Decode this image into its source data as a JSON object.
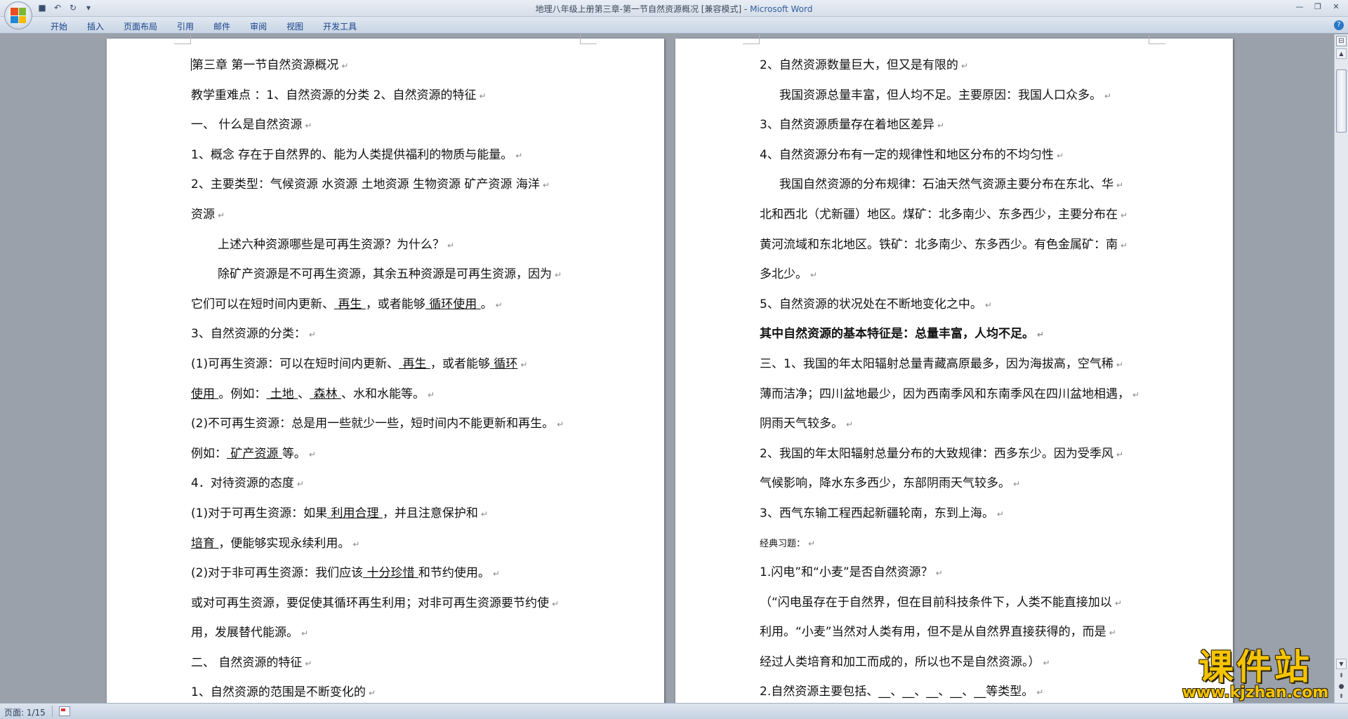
{
  "window": {
    "title": "地理八年级上册第三章-第一节自然资源概况 [兼容模式] - ",
    "app_name": "Microsoft Word"
  },
  "ribbon": {
    "tabs": [
      "开始",
      "插入",
      "页面布局",
      "引用",
      "邮件",
      "审阅",
      "视图",
      "开发工具"
    ]
  },
  "left_page": [
    {
      "t": "第三章 第一节自然资源概况"
    },
    {
      "t": "教学重难点 ：1、自然资源的分类 2、自然资源的特征"
    },
    {
      "t": "一、 什么是自然资源"
    },
    {
      "t": "1、概念 存在于自然界的、能为人类提供福利的物质与能量。"
    },
    {
      "t": "2、主要类型：气候资源 水资源 土地资源 生物资源 矿产资源 海洋"
    },
    {
      "t": "资源"
    },
    {
      "t": "上述六种资源哪些是可再生资源？为什么？",
      "indent": true
    },
    {
      "t": "除矿产资源是不可再生资源，其余五种资源是可再生资源，因为",
      "indent": true
    },
    {
      "a": "它们可以在短时间内更新、",
      "u1": "  再生    ",
      "b": "，或者能够",
      "u2": "  循环使用  ",
      "c": "。"
    },
    {
      "t": "3、自然资源的分类："
    },
    {
      "a": "(1)可再生资源：可以在短时间内更新、",
      "u1": "  再生   ",
      "b": "，或者能够",
      "u2": "  循环",
      "c": ""
    },
    {
      "a": "",
      "u1": "使用  ",
      "b": "。例如：",
      "u2": " 土地  ",
      "c": "、",
      "u3": "  森林  ",
      "d": "、水和水能等。"
    },
    {
      "t": "(2)不可再生资源：总是用一些就少一些，短时间内不能更新和再生。"
    },
    {
      "a": "例如：",
      "u1": "   矿产资源   ",
      "b": "等。"
    },
    {
      "t": "4．对待资源的态度"
    },
    {
      "a": "(1)对于可再生资源：如果",
      "u1": "  利用合理   ",
      "b": "，并且注意保护和"
    },
    {
      "a": "",
      "u1": "  培育     ",
      "b": "，便能够实现永续利用。"
    },
    {
      "a": "(2)对于非可再生资源：我们应该",
      "u1": "  十分珍惜    ",
      "b": "和节约使用。"
    },
    {
      "t": "或对可再生资源，要促使其循环再生利用；对非可再生资源要节约使"
    },
    {
      "t": "用，发展替代能源。"
    },
    {
      "t": "二、 自然资源的特征"
    },
    {
      "t": "1、自然资源的范围是不断变化的"
    }
  ],
  "right_page": [
    {
      "t": "2、自然资源数量巨大，但又是有限的"
    },
    {
      "t": "我国资源总量丰富，但人均不足。主要原因：我国人口众多。",
      "indent1": true
    },
    {
      "t": "3、自然资源质量存在着地区差异"
    },
    {
      "t": "4、自然资源分布有一定的规律性和地区分布的不均匀性"
    },
    {
      "t": "我国自然资源的分布规律：石油天然气资源主要分布在东北、华",
      "indent1": true
    },
    {
      "t": "北和西北（尤新疆）地区。煤矿：北多南少、东多西少，主要分布在"
    },
    {
      "t": "黄河流域和东北地区。铁矿：北多南少、东多西少。有色金属矿：南"
    },
    {
      "t": "多北少。"
    },
    {
      "t": "5、自然资源的状况处在不断地变化之中。"
    },
    {
      "t": "其中自然资源的基本特征是：总量丰富，人均不足。",
      "bold": true
    },
    {
      "t": "三、1、我国的年太阳辐射总量青藏高原最多，因为海拔高，空气稀"
    },
    {
      "t": "薄而洁净；四川盆地最少，因为西南季风和东南季风在四川盆地相遇，"
    },
    {
      "t": "阴雨天气较多。"
    },
    {
      "t": "2、我国的年太阳辐射总量分布的大致规律：西多东少。因为受季风"
    },
    {
      "t": "气候影响，降水东多西少，东部阴雨天气较多。"
    },
    {
      "t": "3、西气东输工程西起新疆轮南，东到上海。"
    },
    {
      "t": "经典习题：",
      "small": true
    },
    {
      "t": "1.闪电”和“小麦”是否自然资源？"
    },
    {
      "t": "（“闪电虽存在于自然界，但在目前科技条件下，人类不能直接加以"
    },
    {
      "t": "利用。“小麦”当然对人类有用，但不是从自然界直接获得的，而是"
    },
    {
      "t": "经过人类培育和加工而成的，所以也不是自然资源。）"
    },
    {
      "t": "2.自然资源主要包括、__、__、__、__、__等类型。"
    }
  ],
  "status": {
    "page": "页面: 1/15"
  },
  "watermark": {
    "cn": "课件站",
    "url": "www.kjzhan.com"
  },
  "paragraph_mark": "↵"
}
